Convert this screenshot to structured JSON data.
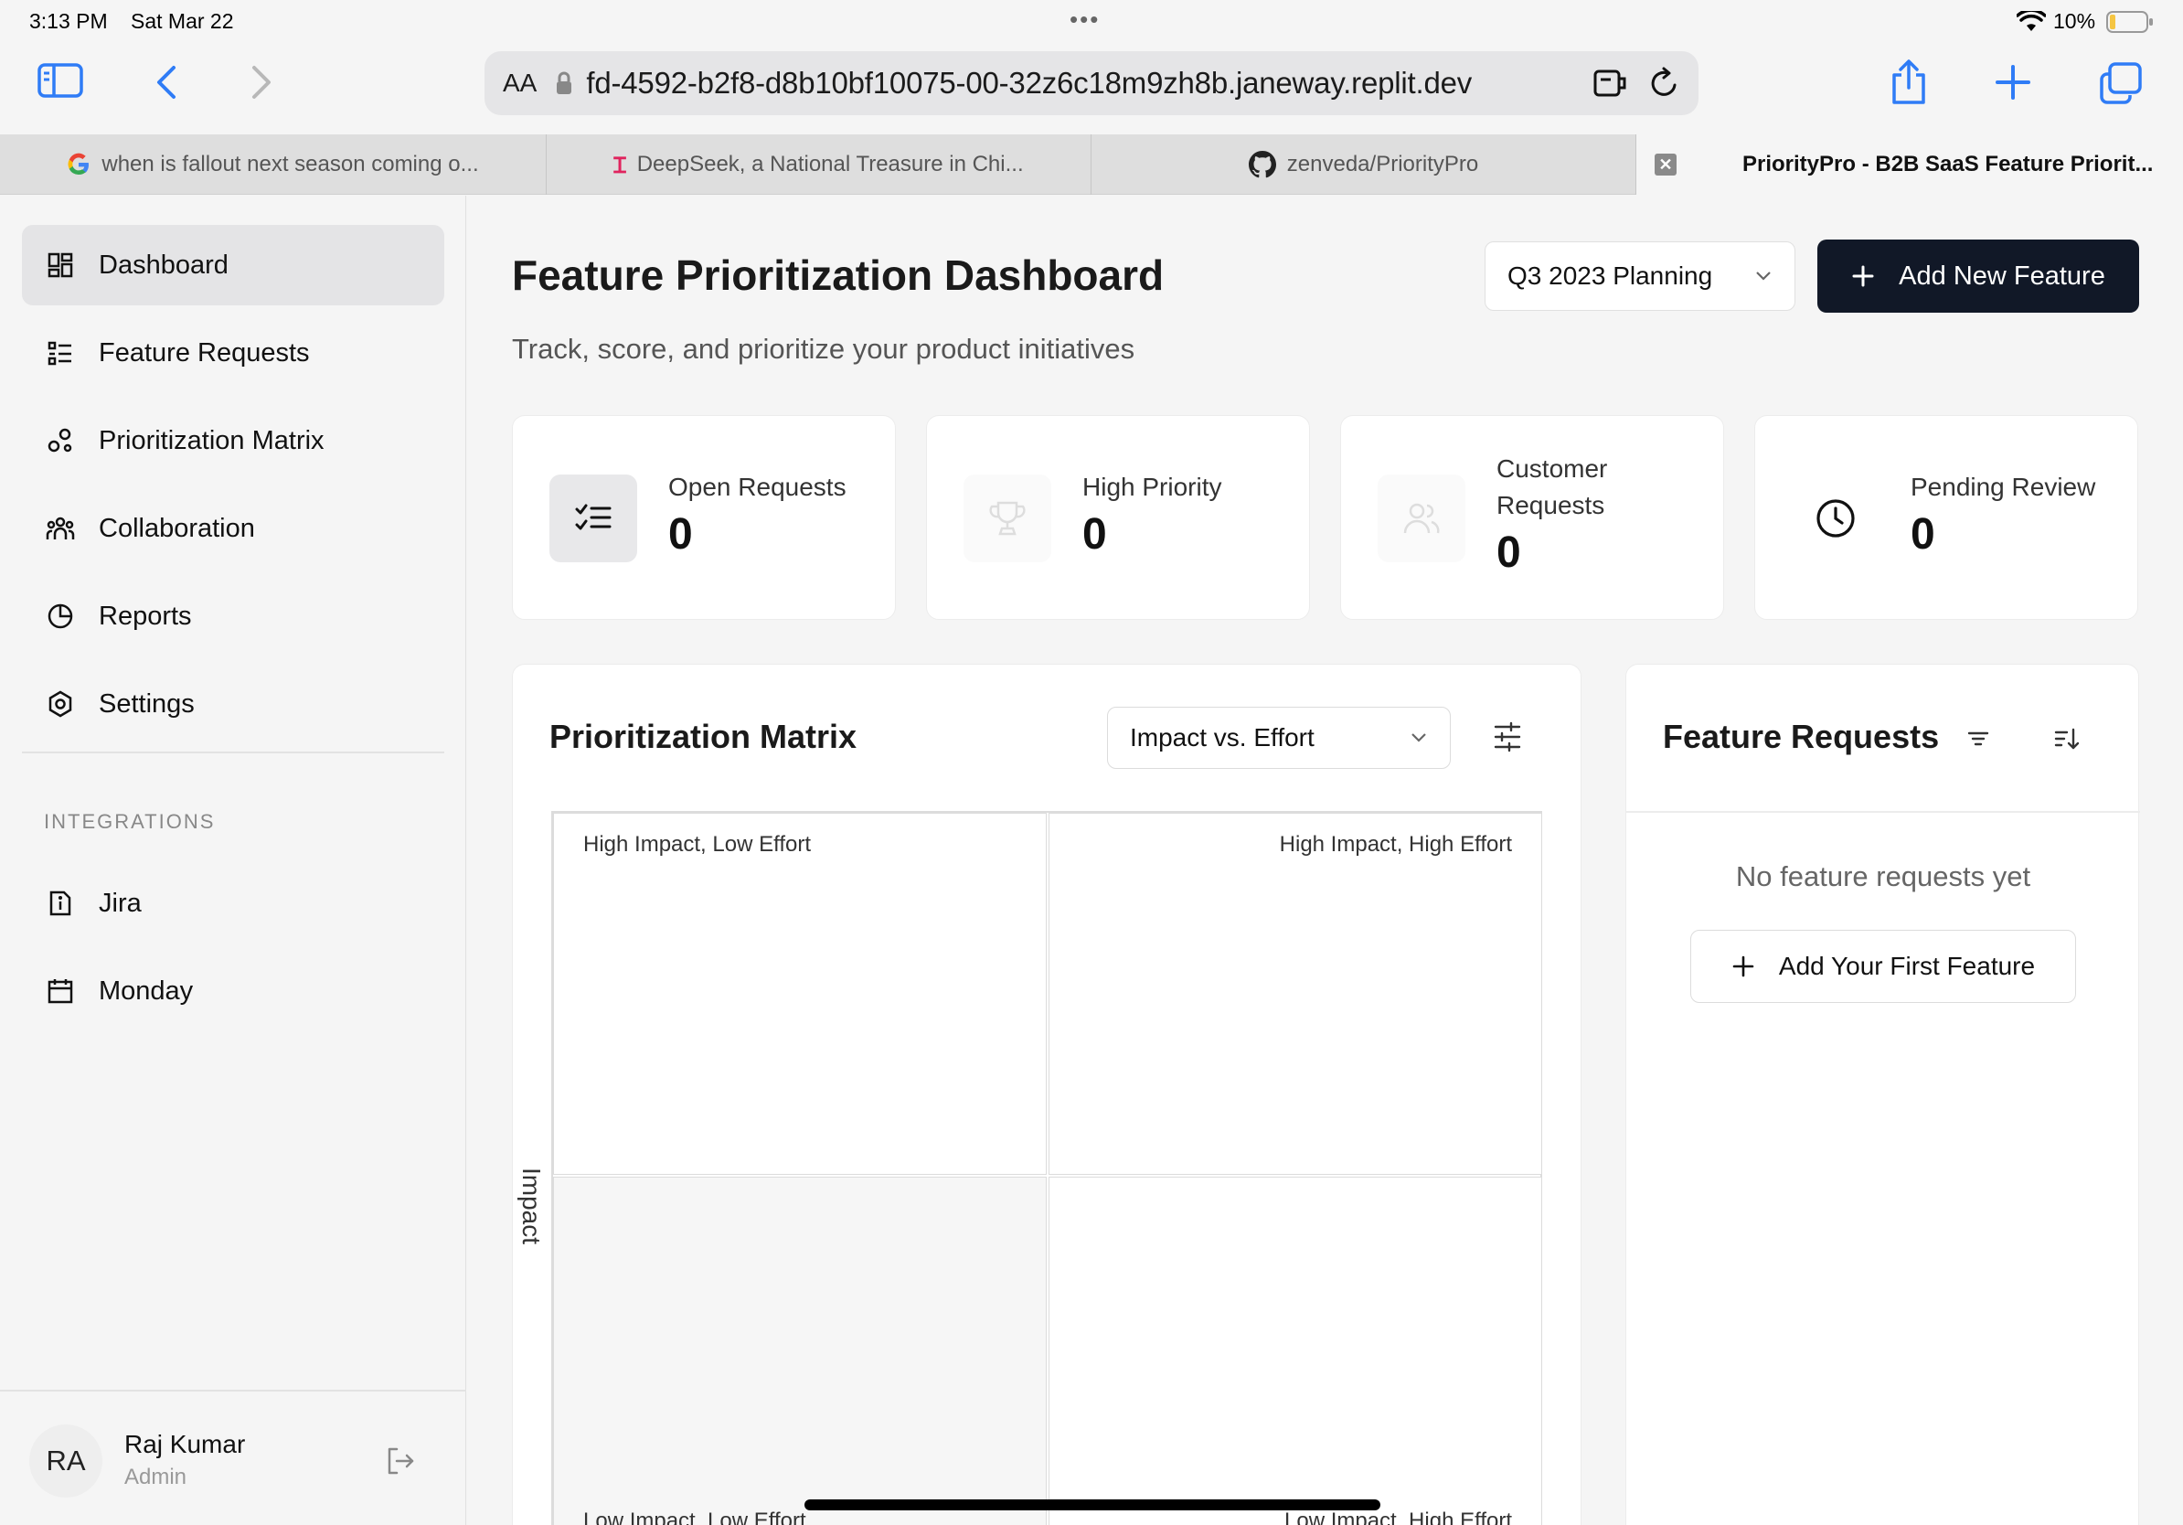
{
  "status": {
    "time": "3:13 PM",
    "date": "Sat Mar 22",
    "battery": "10%"
  },
  "browser": {
    "text_size_label": "AA",
    "url": "fd-4592-b2f8-d8b10bf10075-00-32z6c18m9zh8b.janeway.replit.dev",
    "tabs": [
      {
        "title": "when is fallout next season coming o...",
        "icon": "google-icon"
      },
      {
        "title": "DeepSeek, a National Treasure in Chi...",
        "icon": "news-icon"
      },
      {
        "title": "zenveda/PriorityPro",
        "icon": "github-icon"
      },
      {
        "title": "PriorityPro - B2B SaaS Feature Priorit...",
        "active": true
      }
    ]
  },
  "sidebar": {
    "items": [
      {
        "label": "Dashboard",
        "icon": "dashboard-icon",
        "active": true
      },
      {
        "label": "Feature Requests",
        "icon": "list-icon"
      },
      {
        "label": "Prioritization Matrix",
        "icon": "matrix-icon"
      },
      {
        "label": "Collaboration",
        "icon": "users-icon"
      },
      {
        "label": "Reports",
        "icon": "pie-chart-icon"
      },
      {
        "label": "Settings",
        "icon": "settings-icon"
      }
    ],
    "integrations_heading": "INTEGRATIONS",
    "integrations": [
      {
        "label": "Jira",
        "icon": "jira-icon"
      },
      {
        "label": "Monday",
        "icon": "calendar-icon"
      }
    ],
    "user": {
      "initials": "RA",
      "name": "Raj Kumar",
      "role": "Admin"
    }
  },
  "header": {
    "title": "Feature Prioritization Dashboard",
    "subtitle": "Track, score, and prioritize your product initiatives",
    "period": "Q3 2023 Planning",
    "add_button": "Add New Feature"
  },
  "stats": [
    {
      "label": "Open Requests",
      "value": "0",
      "icon": "checklist-icon"
    },
    {
      "label": "High Priority",
      "value": "0",
      "icon": "trophy-icon"
    },
    {
      "label": "Customer Requests",
      "value": "0",
      "icon": "users-icon"
    },
    {
      "label": "Pending Review",
      "value": "0",
      "icon": "clock-icon"
    }
  ],
  "matrix": {
    "title": "Prioritization Matrix",
    "mode": "Impact vs. Effort",
    "y_axis": "Impact",
    "quadrants": {
      "top_left": "High Impact, Low Effort",
      "top_right": "High Impact, High Effort",
      "bottom_left": "Low Impact, Low Effort",
      "bottom_right": "Low Impact, High Effort"
    }
  },
  "requests": {
    "title": "Feature Requests",
    "empty_text": "No feature requests yet",
    "add_first": "Add Your First Feature"
  },
  "colors": {
    "primary": "#111827",
    "active_nav": "#e4e4e6",
    "background": "#f5f5f5",
    "battery": "#f5c542"
  }
}
